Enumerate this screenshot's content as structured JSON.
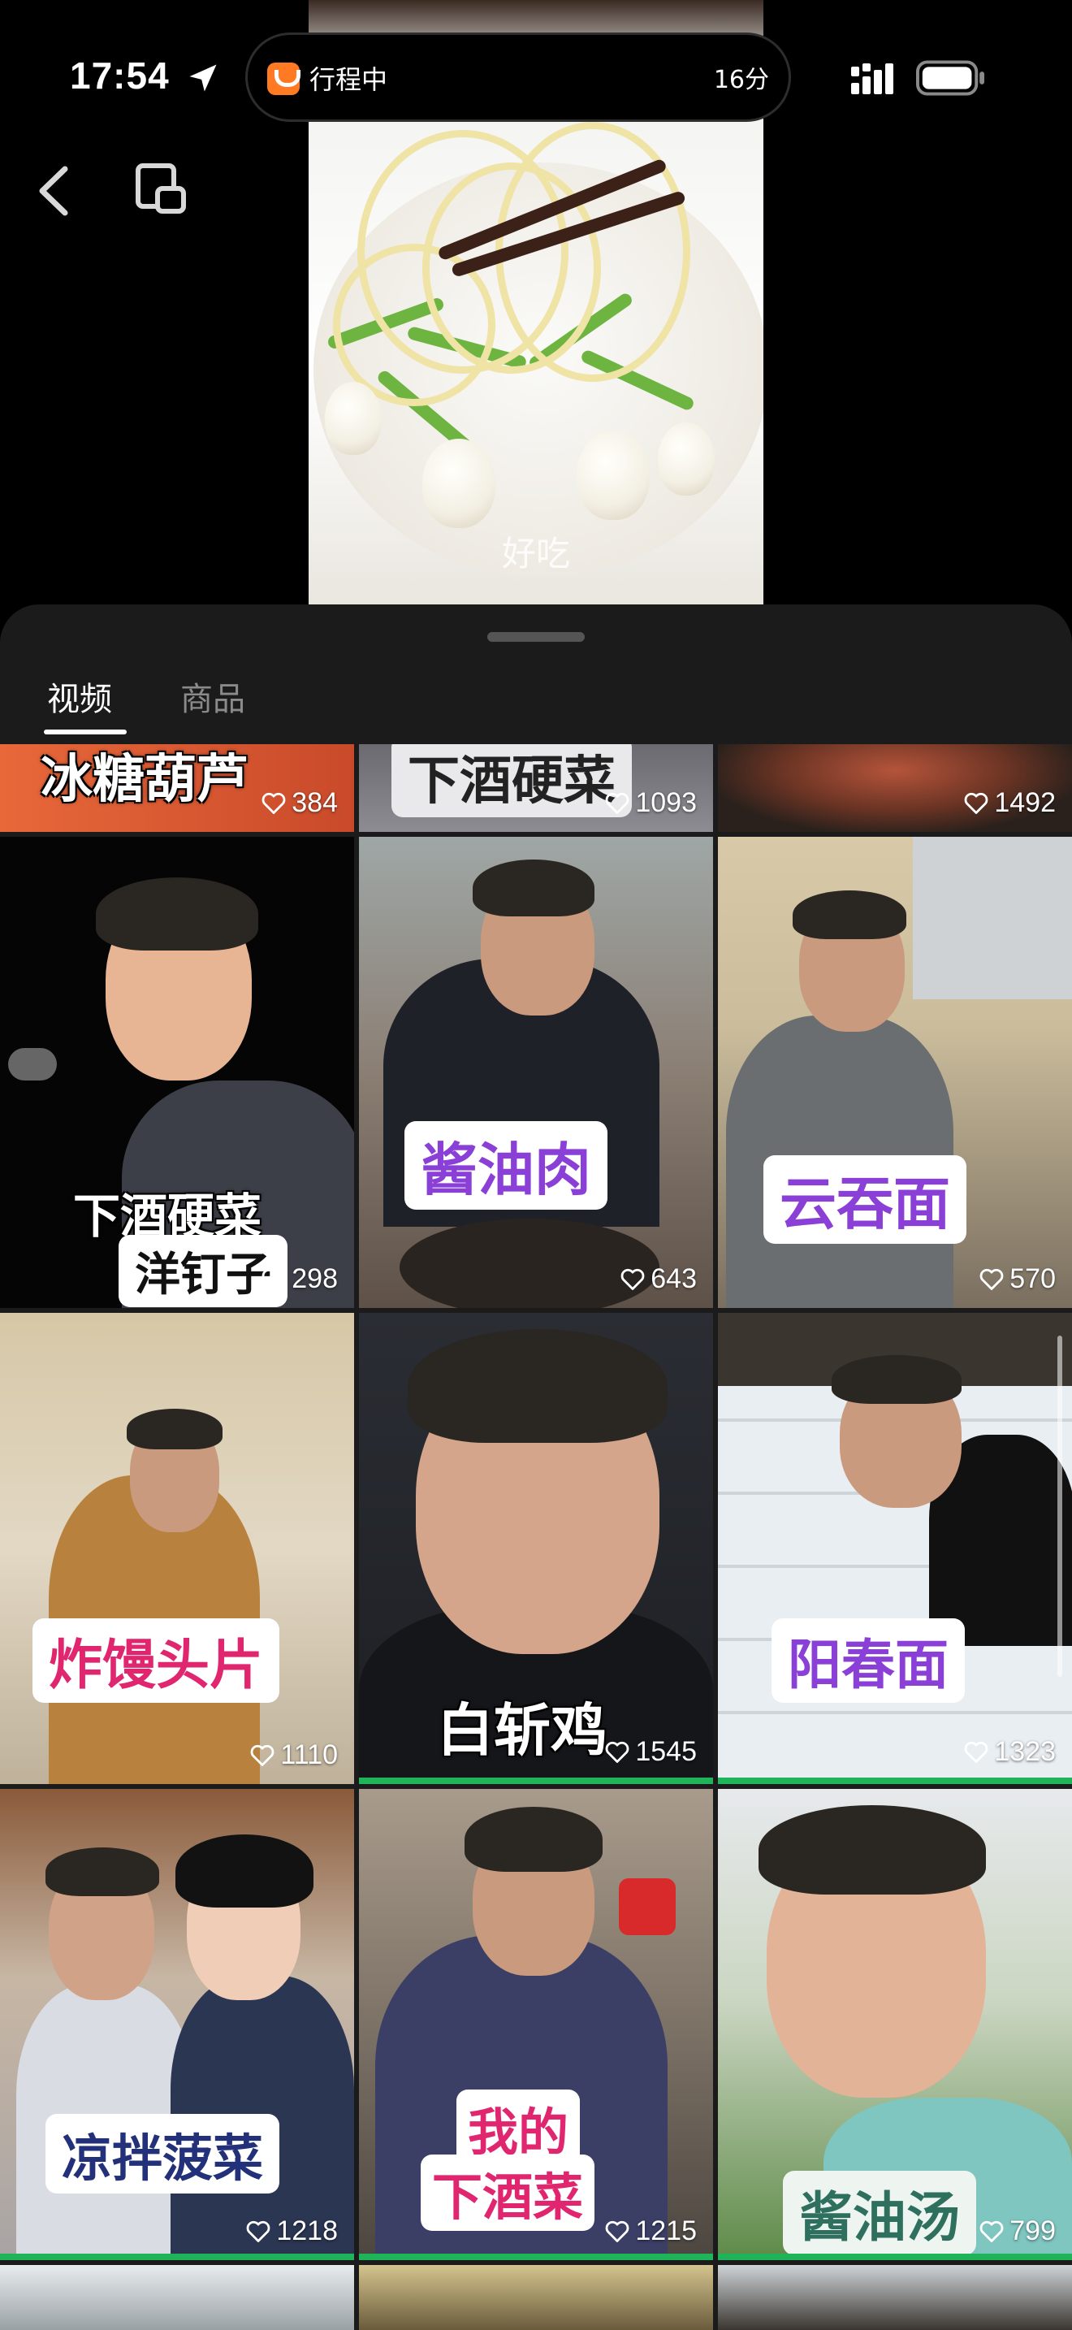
{
  "status_bar": {
    "time": "17:54",
    "trip_label": "行程中",
    "trip_minutes": "16分",
    "icons": [
      "location-arrow-icon",
      "signal-icon",
      "battery-icon"
    ]
  },
  "nav": {
    "icons": [
      "back-chevron-icon",
      "picture-in-picture-icon"
    ]
  },
  "video": {
    "caption": "好吃"
  },
  "tabs": [
    {
      "label": "视频",
      "active": true
    },
    {
      "label": "商品",
      "active": false
    }
  ],
  "grid": {
    "row1": [
      {
        "title": "冰糖葫芦",
        "likes": "384"
      },
      {
        "title": "下酒硬菜",
        "likes": "1093"
      },
      {
        "title": "",
        "likes": "1492"
      }
    ],
    "row2": [
      {
        "title_line1": "下酒硬菜",
        "title_line2": "洋钉子",
        "likes": "298"
      },
      {
        "title": "酱油肉",
        "likes": "643"
      },
      {
        "title": "云吞面",
        "likes": "570"
      }
    ],
    "row3": [
      {
        "title": "炸馒头片",
        "likes": "1110"
      },
      {
        "title": "白斩鸡",
        "likes": "1545"
      },
      {
        "title": "阳春面",
        "likes": "1323"
      }
    ],
    "row4": [
      {
        "title": "凉拌菠菜",
        "likes": "1218"
      },
      {
        "title_line1": "我的",
        "title_line2": "下酒菜",
        "likes": "1215"
      },
      {
        "title": "酱油汤",
        "likes": "799"
      }
    ]
  },
  "colors": {
    "accent_green": "#1fb45a",
    "title_purple": "#8a3fd6",
    "title_pink": "#e0266f",
    "title_navy": "#23307a",
    "title_teal": "#2f6f5e"
  }
}
